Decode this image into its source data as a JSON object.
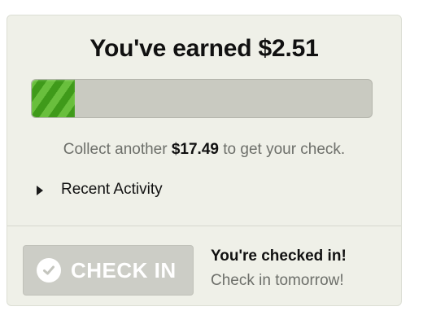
{
  "earnings": {
    "title": "You've earned $2.51",
    "progress_fraction": 0.126
  },
  "collect": {
    "prefix": "Collect another ",
    "amount": "$17.49",
    "suffix": " to get your check."
  },
  "recent_activity": {
    "label": "Recent Activity",
    "icon": "triangle-right-icon"
  },
  "checkin": {
    "button_label": "CHECK IN",
    "button_icon": "checkmark-circle-icon",
    "status_title": "You're checked in!",
    "status_subtitle": "Check in tomorrow!"
  },
  "colors": {
    "panel_bg": "#eff0e8",
    "progress_green": "#3f9a1a",
    "progress_green_light": "#69bf3d",
    "track": "#c9cac1",
    "button_disabled": "#cccdc6",
    "muted_text": "#6d6f6a"
  }
}
